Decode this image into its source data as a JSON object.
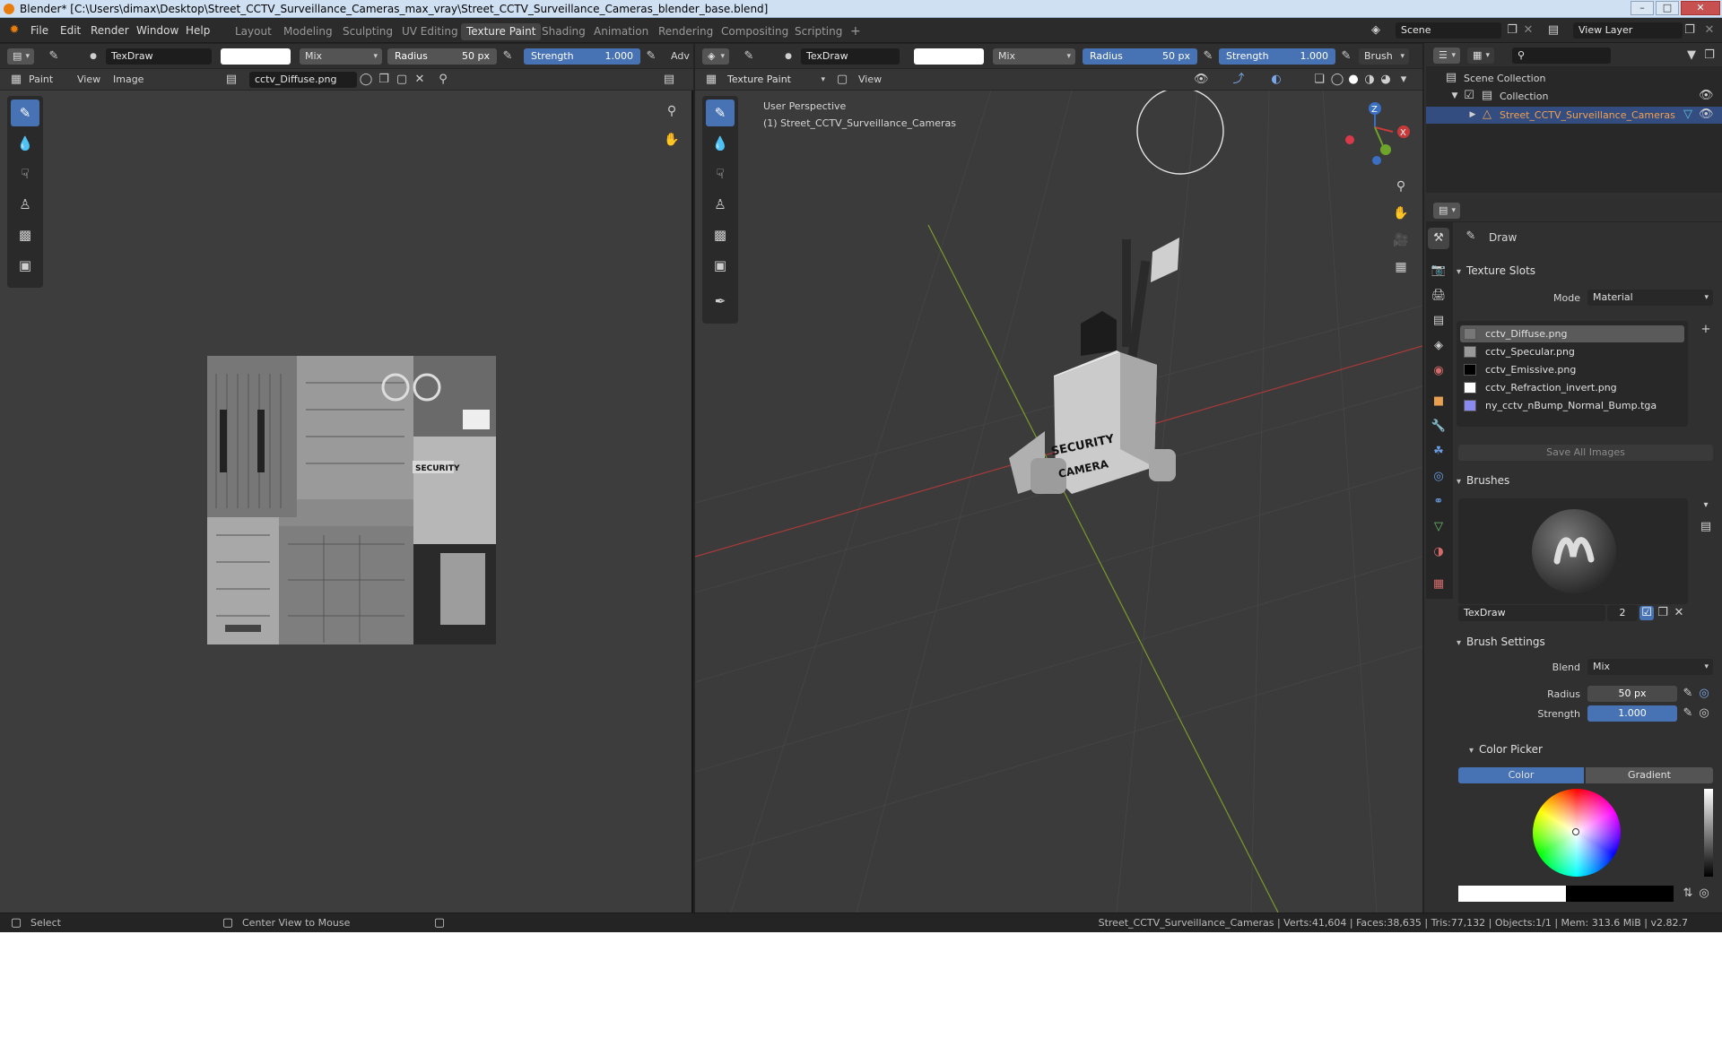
{
  "window": {
    "title": "Blender* [C:\\Users\\dimax\\Desktop\\Street_CCTV_Surveillance_Cameras_max_vray\\Street_CCTV_Surveillance_Cameras_blender_base.blend]"
  },
  "menu": [
    "File",
    "Edit",
    "Render",
    "Window",
    "Help"
  ],
  "workspaces": [
    "Layout",
    "Modeling",
    "Sculpting",
    "UV Editing",
    "Texture Paint",
    "Shading",
    "Animation",
    "Rendering",
    "Compositing",
    "Scripting"
  ],
  "workspace_add": "+",
  "scene": {
    "name": "Scene",
    "view_layer": "View Layer"
  },
  "image_editor": {
    "brush": "TexDraw",
    "blend": "Mix",
    "radius_label": "Radius",
    "radius": "50 px",
    "strength_label": "Strength",
    "strength": "1.000",
    "adv": "Adv",
    "mode": "Paint",
    "view": "View",
    "image_menu": "Image",
    "image_name": "cctv_Diffuse.png",
    "texture_tag": "SECURITY"
  },
  "viewport": {
    "brush": "TexDraw",
    "blend": "Mix",
    "radius_label": "Radius",
    "radius": "50 px",
    "strength_label": "Strength",
    "strength": "1.000",
    "brush_menu": "Brush",
    "mode": "Texture Paint",
    "view": "View",
    "perspective": "User Perspective",
    "object_info": "(1) Street_CCTV_Surveillance_Cameras",
    "box_text1": "SECURITY",
    "box_text2": "CAMERA",
    "axis_z": "Z",
    "axis_x": "X"
  },
  "outliner": {
    "scene_collection": "Scene Collection",
    "collection": "Collection",
    "object": "Street_CCTV_Surveillance_Cameras"
  },
  "properties": {
    "active_tool": "Draw",
    "texture_slots": {
      "title": "Texture Slots",
      "mode_label": "Mode",
      "mode": "Material",
      "slots": [
        "cctv_Diffuse.png",
        "cctv_Specular.png",
        "cctv_Emissive.png",
        "cctv_Refraction_invert.png",
        "ny_cctv_nBump_Normal_Bump.tga"
      ],
      "save_all": "Save All Images"
    },
    "brushes": {
      "title": "Brushes",
      "name": "TexDraw",
      "users": "2"
    },
    "brush_settings": {
      "title": "Brush Settings",
      "blend_label": "Blend",
      "blend": "Mix",
      "radius_label": "Radius",
      "radius": "50 px",
      "strength_label": "Strength",
      "strength": "1.000"
    },
    "color_picker": {
      "title": "Color Picker",
      "tab_color": "Color",
      "tab_gradient": "Gradient"
    }
  },
  "status": {
    "select": "Select",
    "center_view": "Center View to Mouse",
    "info": "Street_CCTV_Surveillance_Cameras | Verts:41,604 | Faces:38,635 | Tris:77,132 | Objects:1/1 | Mem: 313.6 MiB | v2.82.7"
  },
  "colors": {
    "accent": "#4772b3",
    "brush_color": "#ffffff",
    "title_bg": "#cfe0f3"
  }
}
